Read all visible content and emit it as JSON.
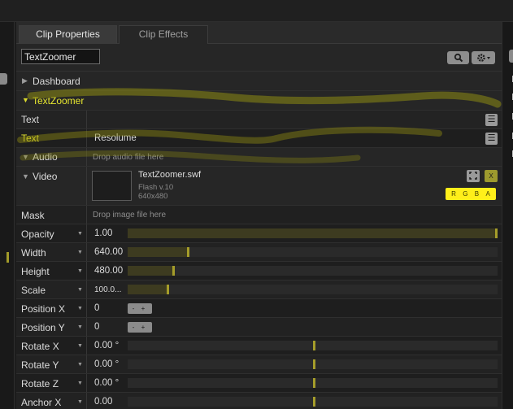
{
  "tabs": [
    {
      "label": "Clip Properties",
      "active": true
    },
    {
      "label": "Clip Effects",
      "active": false
    }
  ],
  "clip_name": "TextZoomer",
  "sections": {
    "dashboard": "Dashboard",
    "textzoomer": "TextZoomer",
    "audio": "Audio",
    "video": "Video"
  },
  "params": {
    "text_header": "Text",
    "text_label": "Text",
    "text_value": "Resolume",
    "audio_hint": "Drop audio file here",
    "mask_label": "Mask",
    "mask_hint": "Drop image file here"
  },
  "video": {
    "file": "TextZoomer.swf",
    "format": "Flash v.10",
    "resolution": "640x480",
    "channels": [
      "R",
      "G",
      "B",
      "A"
    ],
    "fit_icon": "fit-screen-icon",
    "close_label": "X"
  },
  "sliders": [
    {
      "label": "Opacity",
      "value": "1.00",
      "level": 1.0,
      "type": "fill"
    },
    {
      "label": "Width",
      "value": "640.00",
      "level": 0.16,
      "type": "fill"
    },
    {
      "label": "Height",
      "value": "480.00",
      "level": 0.12,
      "type": "fill"
    },
    {
      "label": "Scale",
      "value": "100.0...",
      "level": 0.105,
      "type": "fill",
      "small": true
    },
    {
      "label": "Position X",
      "value": "0",
      "type": "stepper"
    },
    {
      "label": "Position Y",
      "value": "0",
      "type": "stepper"
    },
    {
      "label": "Rotate X",
      "value": "0.00 °",
      "level": 0.5,
      "type": "center"
    },
    {
      "label": "Rotate Y",
      "value": "0.00 °",
      "level": 0.5,
      "type": "center"
    },
    {
      "label": "Rotate Z",
      "value": "0.00 °",
      "level": 0.5,
      "type": "center"
    },
    {
      "label": "Anchor X",
      "value": "0.00",
      "level": 0.5,
      "type": "center"
    }
  ],
  "stepper_label": "- +",
  "icons": {
    "search": "search-icon",
    "gear": "gear-icon",
    "menu": "menu-icon",
    "expand": "triangle-right-icon",
    "collapse": "triangle-down-icon",
    "param_menu": "caret-down-icon"
  },
  "colors": {
    "accent": "#e6e62f",
    "slider_knob": "#a59d2a",
    "rgba_bg": "#ffef1a"
  }
}
